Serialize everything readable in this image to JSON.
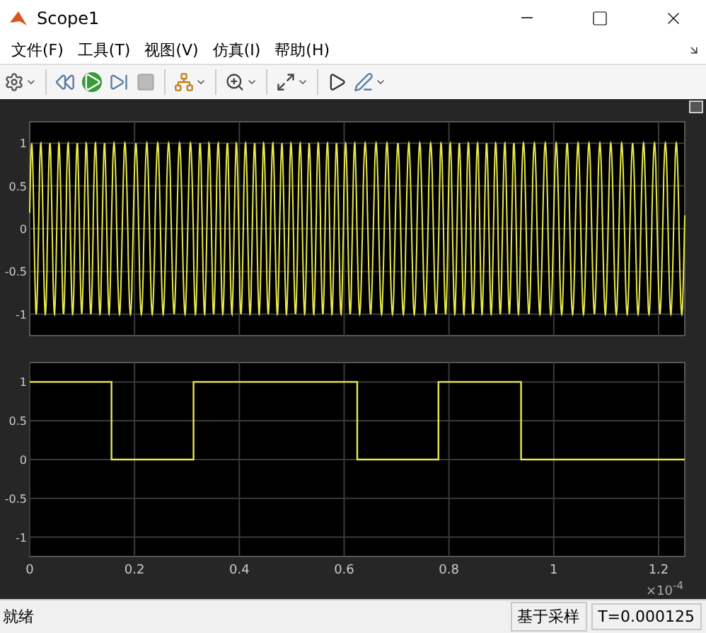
{
  "window": {
    "title": "Scope1"
  },
  "menu": [
    "文件(F)",
    "工具(T)",
    "视图(V)",
    "仿真(I)",
    "帮助(H)"
  ],
  "top_plot": {
    "y_tick_labels": [
      "1",
      "0.5",
      "0",
      "-0.5",
      "-1"
    ]
  },
  "bottom_plot": {
    "x_scale_label": "×10$^{-4}$",
    "chart_data": {
      "type": "line",
      "x": [
        0,
        0.156,
        0.156,
        0.3125,
        0.3125,
        0.625,
        0.625,
        0.78,
        0.78,
        0.9375,
        0.9375,
        1.25
      ],
      "grid": true,
      "series": [
        {
          "color": "#e8e84a",
          "values": [
            1,
            1,
            0,
            0,
            1,
            1,
            0,
            0,
            1,
            1,
            0,
            0
          ]
        }
      ],
      "xlim": [
        0,
        1.25
      ],
      "ylim": [
        -1.25,
        1.25
      ],
      "xticks": [
        0,
        0.2,
        0.4,
        0.6,
        0.8,
        1,
        1.2
      ],
      "yticks": [
        -1,
        -0.5,
        0,
        0.5,
        1
      ]
    }
  },
  "status_bar": {
    "message": "就绪",
    "mode": "基于采样",
    "time": "T=0.000125"
  }
}
